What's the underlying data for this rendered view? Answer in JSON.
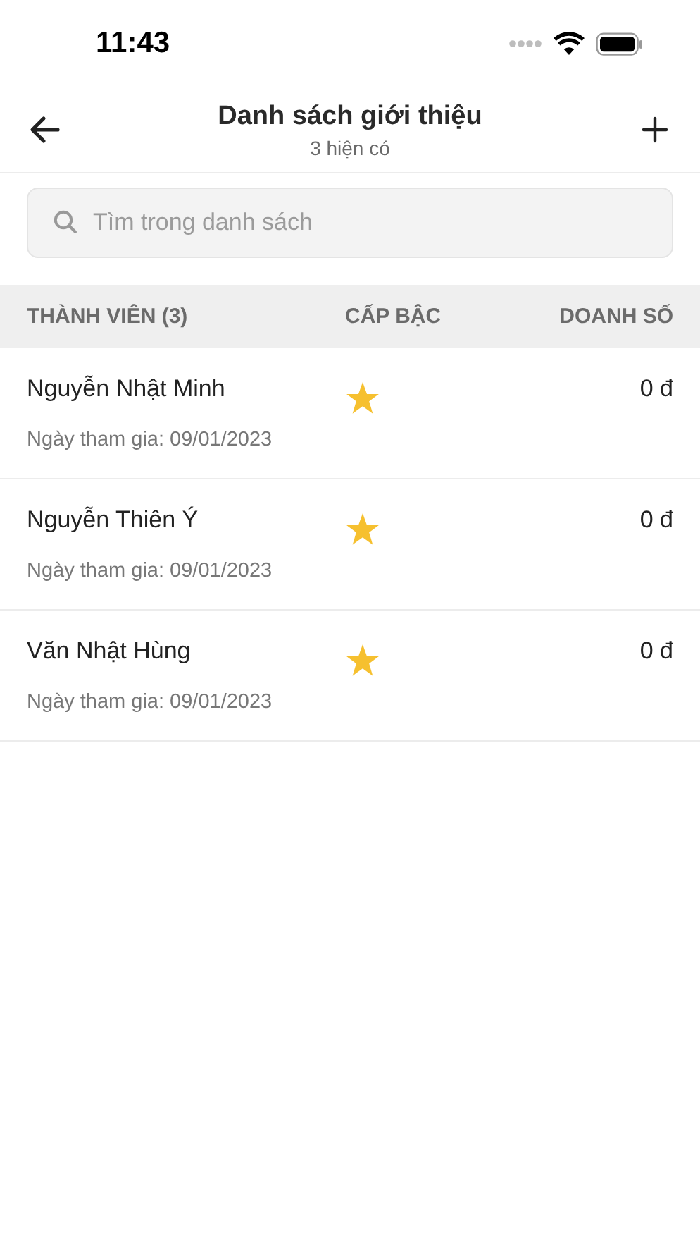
{
  "status_bar": {
    "time": "11:43"
  },
  "nav": {
    "title": "Danh sách giới thiệu",
    "subtitle": "3 hiện có"
  },
  "search": {
    "placeholder": "Tìm trong danh sách"
  },
  "table": {
    "columns": [
      "THÀNH VIÊN (3)",
      "CẤP BẬC",
      "DOANH SỐ"
    ],
    "rows": [
      {
        "name": "Nguyễn Nhật Minh",
        "joined": "Ngày tham gia: 09/01/2023",
        "revenue": "0 đ"
      },
      {
        "name": "Nguyễn Thiên Ý",
        "joined": "Ngày tham gia: 09/01/2023",
        "revenue": "0 đ"
      },
      {
        "name": "Văn Nhật Hùng",
        "joined": "Ngày tham gia: 09/01/2023",
        "revenue": "0 đ"
      }
    ]
  }
}
